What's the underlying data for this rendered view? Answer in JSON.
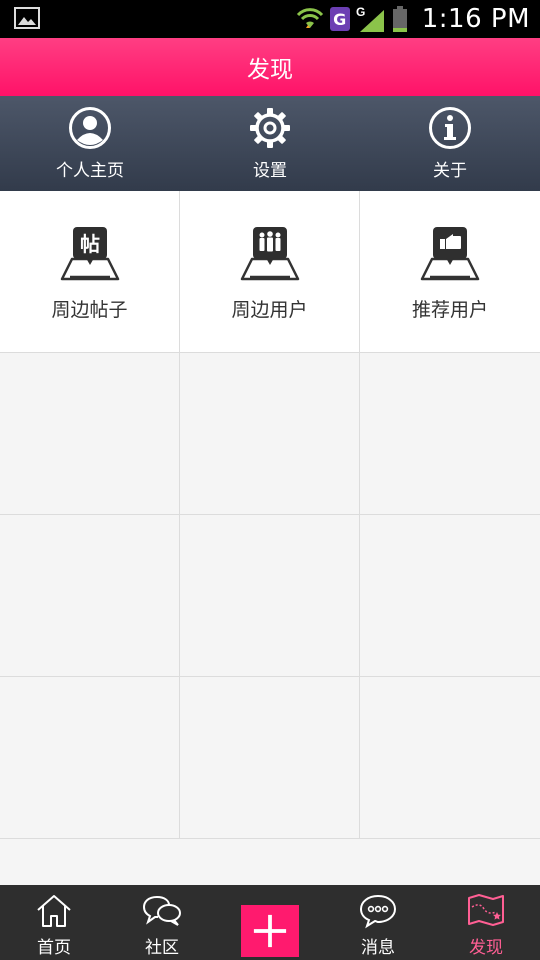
{
  "status_bar": {
    "time": "1:16 PM",
    "network_label": "G"
  },
  "title": "发现",
  "top_nav": [
    {
      "label": "个人主页",
      "icon": "user-profile-icon"
    },
    {
      "label": "设置",
      "icon": "gear-icon"
    },
    {
      "label": "关于",
      "icon": "info-icon"
    }
  ],
  "features": [
    {
      "label": "周边帖子",
      "icon": "nearby-posts-icon",
      "glyph": "帖"
    },
    {
      "label": "周边用户",
      "icon": "nearby-users-icon"
    },
    {
      "label": "推荐用户",
      "icon": "recommend-users-icon"
    }
  ],
  "bottom_nav": [
    {
      "label": "首页",
      "icon": "home-icon"
    },
    {
      "label": "社区",
      "icon": "community-icon"
    },
    {
      "label": "",
      "icon": "plus-icon"
    },
    {
      "label": "消息",
      "icon": "message-icon"
    },
    {
      "label": "发现",
      "icon": "discover-map-icon",
      "active": true
    }
  ],
  "colors": {
    "accent": "#ff1a6e",
    "active_tab": "#ff5f94",
    "nav_dark": "#3c4555"
  }
}
